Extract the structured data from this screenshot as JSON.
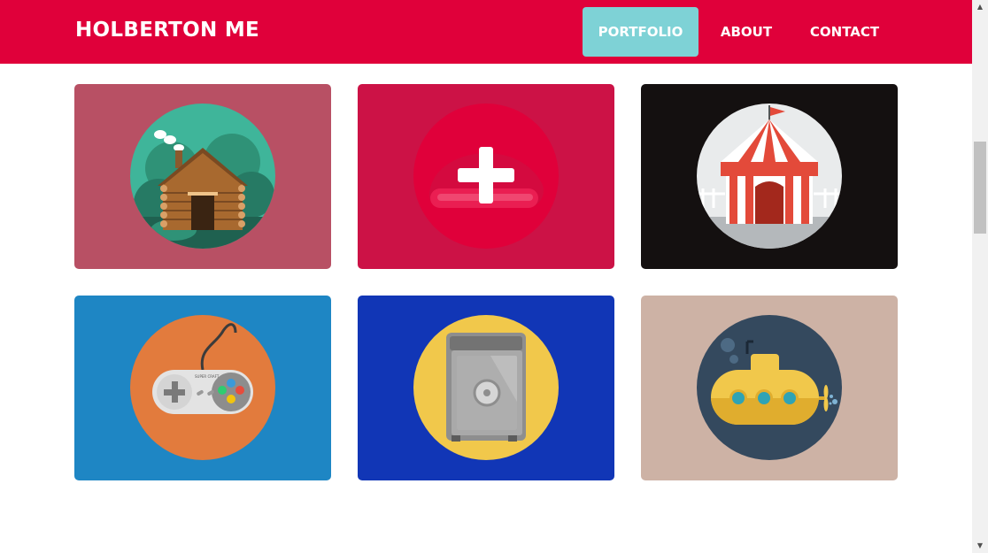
{
  "brand": {
    "title": "HOLBERTON ME"
  },
  "nav": {
    "items": [
      {
        "label": "PORTFOLIO",
        "active": true
      },
      {
        "label": "ABOUT",
        "active": false
      },
      {
        "label": "CONTACT",
        "active": false
      }
    ],
    "active_color": "#7ed2d6"
  },
  "colors": {
    "header": "#e0003a",
    "page_background": "#ffffff"
  },
  "portfolio": {
    "cards": [
      {
        "icon": "log-cabin-icon",
        "background": "#b85064",
        "circle": "#3fb59a"
      },
      {
        "icon": "skateboard-plus-icon",
        "background": "#cc1246",
        "circle": "#e0003a"
      },
      {
        "icon": "circus-tent-icon",
        "background": "#141010",
        "circle": "#e9ebec"
      },
      {
        "icon": "game-controller-icon",
        "background": "#1e86c4",
        "circle": "#e27b3d"
      },
      {
        "icon": "safe-icon",
        "background": "#1136b6",
        "circle": "#f1c84b"
      },
      {
        "icon": "submarine-icon",
        "background": "#cdb2a5",
        "circle": "#34495e"
      }
    ],
    "controller_label": "SUPER CRAFT"
  }
}
